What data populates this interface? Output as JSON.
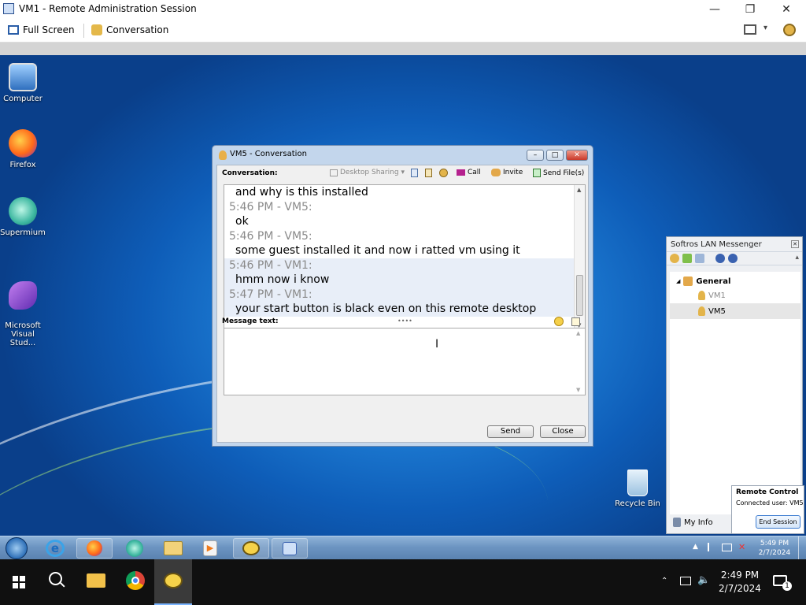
{
  "window": {
    "title": "VM1 - Remote Administration Session"
  },
  "toolbar": {
    "fullscreen": "Full Screen",
    "conversation": "Conversation"
  },
  "desktop": {
    "icons": [
      {
        "label": "Computer"
      },
      {
        "label": "Firefox"
      },
      {
        "label": "Supermium"
      },
      {
        "label": "Microsoft\nVisual Stud..."
      },
      {
        "label": "Recycle Bin"
      }
    ]
  },
  "conv": {
    "title": "VM5 - Conversation",
    "conversation_label": "Conversation:",
    "desktop_sharing": "Desktop Sharing",
    "call": "Call",
    "invite": "Invite",
    "send_files": "Send File(s)",
    "lines": [
      {
        "kind": "msg",
        "text": "and why is this installed"
      },
      {
        "kind": "hdr",
        "text": "5:46 PM - VM5:"
      },
      {
        "kind": "msg",
        "text": "ok"
      },
      {
        "kind": "hdr",
        "text": "5:46 PM - VM5:"
      },
      {
        "kind": "msg",
        "text": "some guest installed it and now i ratted vm using it"
      },
      {
        "kind": "hdr",
        "text": "5:46 PM - VM1:"
      },
      {
        "kind": "msg",
        "text": "hmm now i know"
      },
      {
        "kind": "hdr",
        "text": "5:47 PM - VM1:"
      },
      {
        "kind": "msg",
        "text": "your start button is black even on this remote desktop"
      }
    ],
    "message_label": "Message text:",
    "send": "Send",
    "close": "Close"
  },
  "messenger": {
    "title": "Softros LAN Messenger",
    "group": "General",
    "users": [
      "VM1",
      "VM5"
    ],
    "myinfo": "My Info"
  },
  "remote": {
    "title": "Remote Control",
    "connected_label": "Connected user:",
    "connected_user": "VM5",
    "end": "End Session"
  },
  "rtray": {
    "time": "5:49 PM",
    "date": "2/7/2024"
  },
  "htray": {
    "time": "2:49 PM",
    "date": "2/7/2024",
    "notifications": "1"
  },
  "colors": {
    "accent": "#1f7fd6",
    "host_taskbar": "#101010"
  }
}
